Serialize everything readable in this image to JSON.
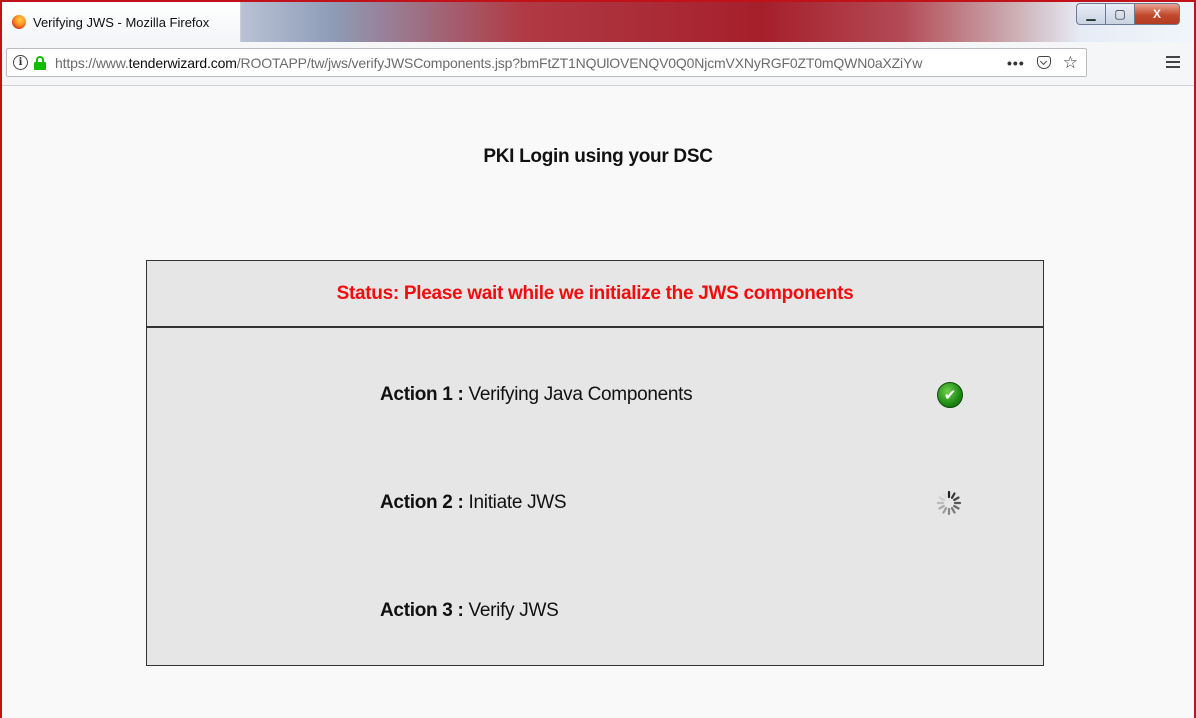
{
  "window": {
    "title": "Verifying JWS - Mozilla Firefox",
    "controls": {
      "minimize": "▁",
      "maximize": "▢",
      "close": "X"
    }
  },
  "navbar": {
    "url_prefix": "https://www.",
    "url_domain": "tenderwizard.com",
    "url_path": "/ROOTAPP/tw/jws/verifyJWSComponents.jsp?bmFtZT1NQUlOVENQV0Q0NjcmVXNyRGF0ZT0mQWN0aXZiYw",
    "more_label": "•••",
    "icons": [
      "info-icon",
      "lock-icon",
      "page-actions-icon",
      "pocket-icon",
      "star-icon",
      "menu-icon"
    ]
  },
  "page": {
    "title": "PKI Login using your DSC",
    "status": "Status: Please wait while we initialize the JWS components",
    "status_color": "#f20d0d",
    "actions": [
      {
        "label": "Action 1 :",
        "text": " Verifying Java Components",
        "state": "done"
      },
      {
        "label": "Action 2 :",
        "text": " Initiate JWS",
        "state": "loading"
      },
      {
        "label": "Action 3 :",
        "text": " Verify JWS",
        "state": "pending"
      }
    ],
    "check_glyph": "✔"
  }
}
